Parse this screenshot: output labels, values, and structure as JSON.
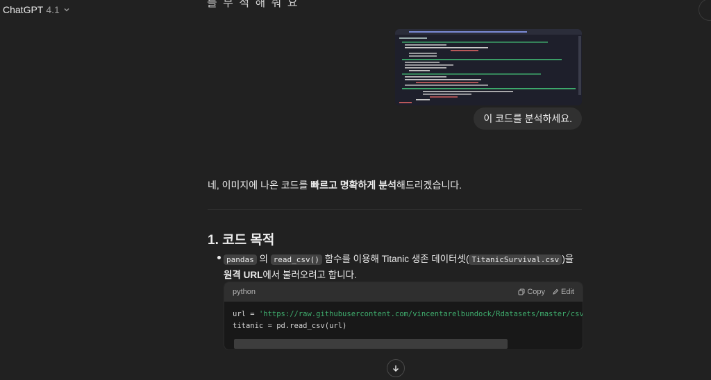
{
  "header": {
    "model_name": "ChatGPT",
    "model_version": "4.1"
  },
  "conversation": {
    "partial_top_text": "를 부 적 해 줘 요",
    "user_message": "이 코드를 분석하세요.",
    "reply_intro": {
      "before": "네, 이미지에 나온 코드를 ",
      "bold1": "빠르고",
      "mid": " ",
      "bold2": "명확하게 분석",
      "after": "해드리겠습니다."
    },
    "section_title": "1. 코드 목적",
    "bullet": {
      "code1": "pandas",
      "t1": " 의 ",
      "code2": "read_csv()",
      "t2": " 함수를 이용해 Titanic 생존 데이터셋(",
      "code3": "TitanicSurvival.csv",
      "t3": ")을 ",
      "bold": "원격 URL",
      "t4": "에서 불러오려고 합니다."
    },
    "code_block": {
      "language": "python",
      "copy_label": "Copy",
      "edit_label": "Edit",
      "line1_prefix": "url = ",
      "line1_string": "'https://raw.githubusercontent.com/vincentarelbundock/Rdatasets/master/csv/carData/Tita",
      "line2": "titanic = pd.read_csv(url)"
    }
  },
  "icons": {
    "model_chevron": "chevron-down-icon",
    "copy": "copy-icon",
    "edit": "edit-icon",
    "scroll_down": "arrow-down-icon"
  },
  "colors": {
    "background": "#212121",
    "bubble": "#303030",
    "code_header": "#2f2f2f",
    "string": "#3fae6e"
  }
}
